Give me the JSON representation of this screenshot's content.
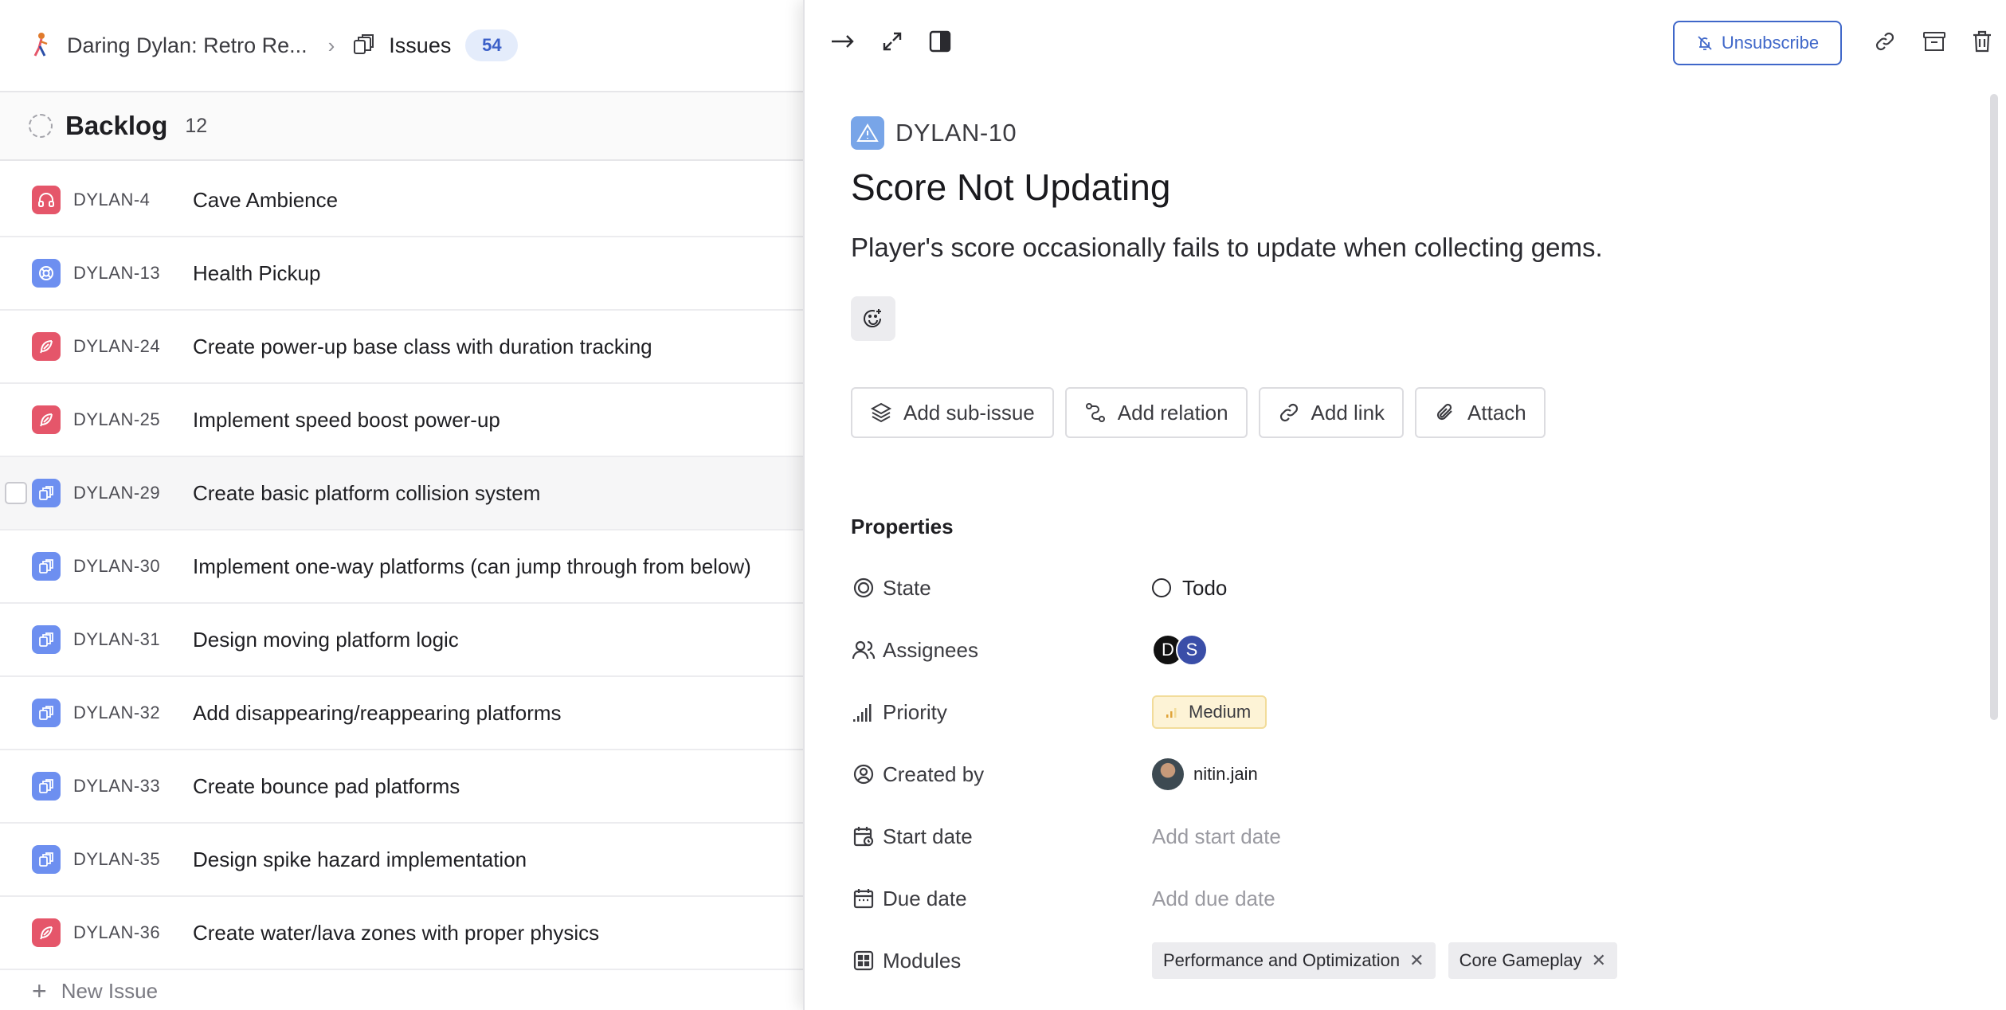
{
  "header": {
    "project_name": "Daring Dylan: Retro Re...",
    "section": "Issues",
    "issue_count": "54"
  },
  "group": {
    "title": "Backlog",
    "count": "12"
  },
  "rows": [
    {
      "id": "DYLAN-4",
      "title": "Cave Ambience",
      "icon": "headphones-icon",
      "color": "#e5566a"
    },
    {
      "id": "DYLAN-13",
      "title": "Health Pickup",
      "icon": "lifebuoy-icon",
      "color": "#6d8ff0"
    },
    {
      "id": "DYLAN-24",
      "title": "Create power-up base class with duration tracking",
      "icon": "feather-icon",
      "color": "#e5566a"
    },
    {
      "id": "DYLAN-25",
      "title": "Implement speed boost power-up",
      "icon": "feather-icon",
      "color": "#e5566a"
    },
    {
      "id": "DYLAN-29",
      "title": "Create basic platform collision system",
      "icon": "layers-icon",
      "color": "#6d8ff0"
    },
    {
      "id": "DYLAN-30",
      "title": "Implement one-way platforms (can jump through from below)",
      "icon": "layers-icon",
      "color": "#6d8ff0"
    },
    {
      "id": "DYLAN-31",
      "title": "Design moving platform logic",
      "icon": "layers-icon",
      "color": "#6d8ff0"
    },
    {
      "id": "DYLAN-32",
      "title": "Add disappearing/reappearing platforms",
      "icon": "layers-icon",
      "color": "#6d8ff0"
    },
    {
      "id": "DYLAN-33",
      "title": "Create bounce pad platforms",
      "icon": "layers-icon",
      "color": "#6d8ff0"
    },
    {
      "id": "DYLAN-35",
      "title": "Design spike hazard implementation",
      "icon": "layers-icon",
      "color": "#6d8ff0"
    },
    {
      "id": "DYLAN-36",
      "title": "Create water/lava zones with proper physics",
      "icon": "feather-icon",
      "color": "#e5566a"
    }
  ],
  "new_issue_label": "New Issue",
  "peek": {
    "unsubscribe_label": "Unsubscribe",
    "issue_key": "DYLAN-10",
    "title": "Score Not Updating",
    "description": "Player's score occasionally fails to update when collecting gems.",
    "actions": {
      "sub_issue": "Add sub-issue",
      "relation": "Add relation",
      "link": "Add link",
      "attach": "Attach"
    },
    "properties_title": "Properties",
    "properties": {
      "state_label": "State",
      "state_value": "Todo",
      "assignees_label": "Assignees",
      "assignee_1": "D",
      "assignee_2": "S",
      "priority_label": "Priority",
      "priority_value": "Medium",
      "created_by_label": "Created by",
      "created_by_value": "nitin.jain",
      "start_date_label": "Start date",
      "start_date_placeholder": "Add start date",
      "due_date_label": "Due date",
      "due_date_placeholder": "Add due date",
      "modules_label": "Modules",
      "modules": [
        "Performance and Optimization",
        "Core Gameplay"
      ]
    }
  },
  "colors": {
    "accent": "#3f67c9",
    "bug_icon": "#e5566a",
    "task_icon": "#6d8ff0",
    "priority_bg": "#fdf3d6"
  }
}
